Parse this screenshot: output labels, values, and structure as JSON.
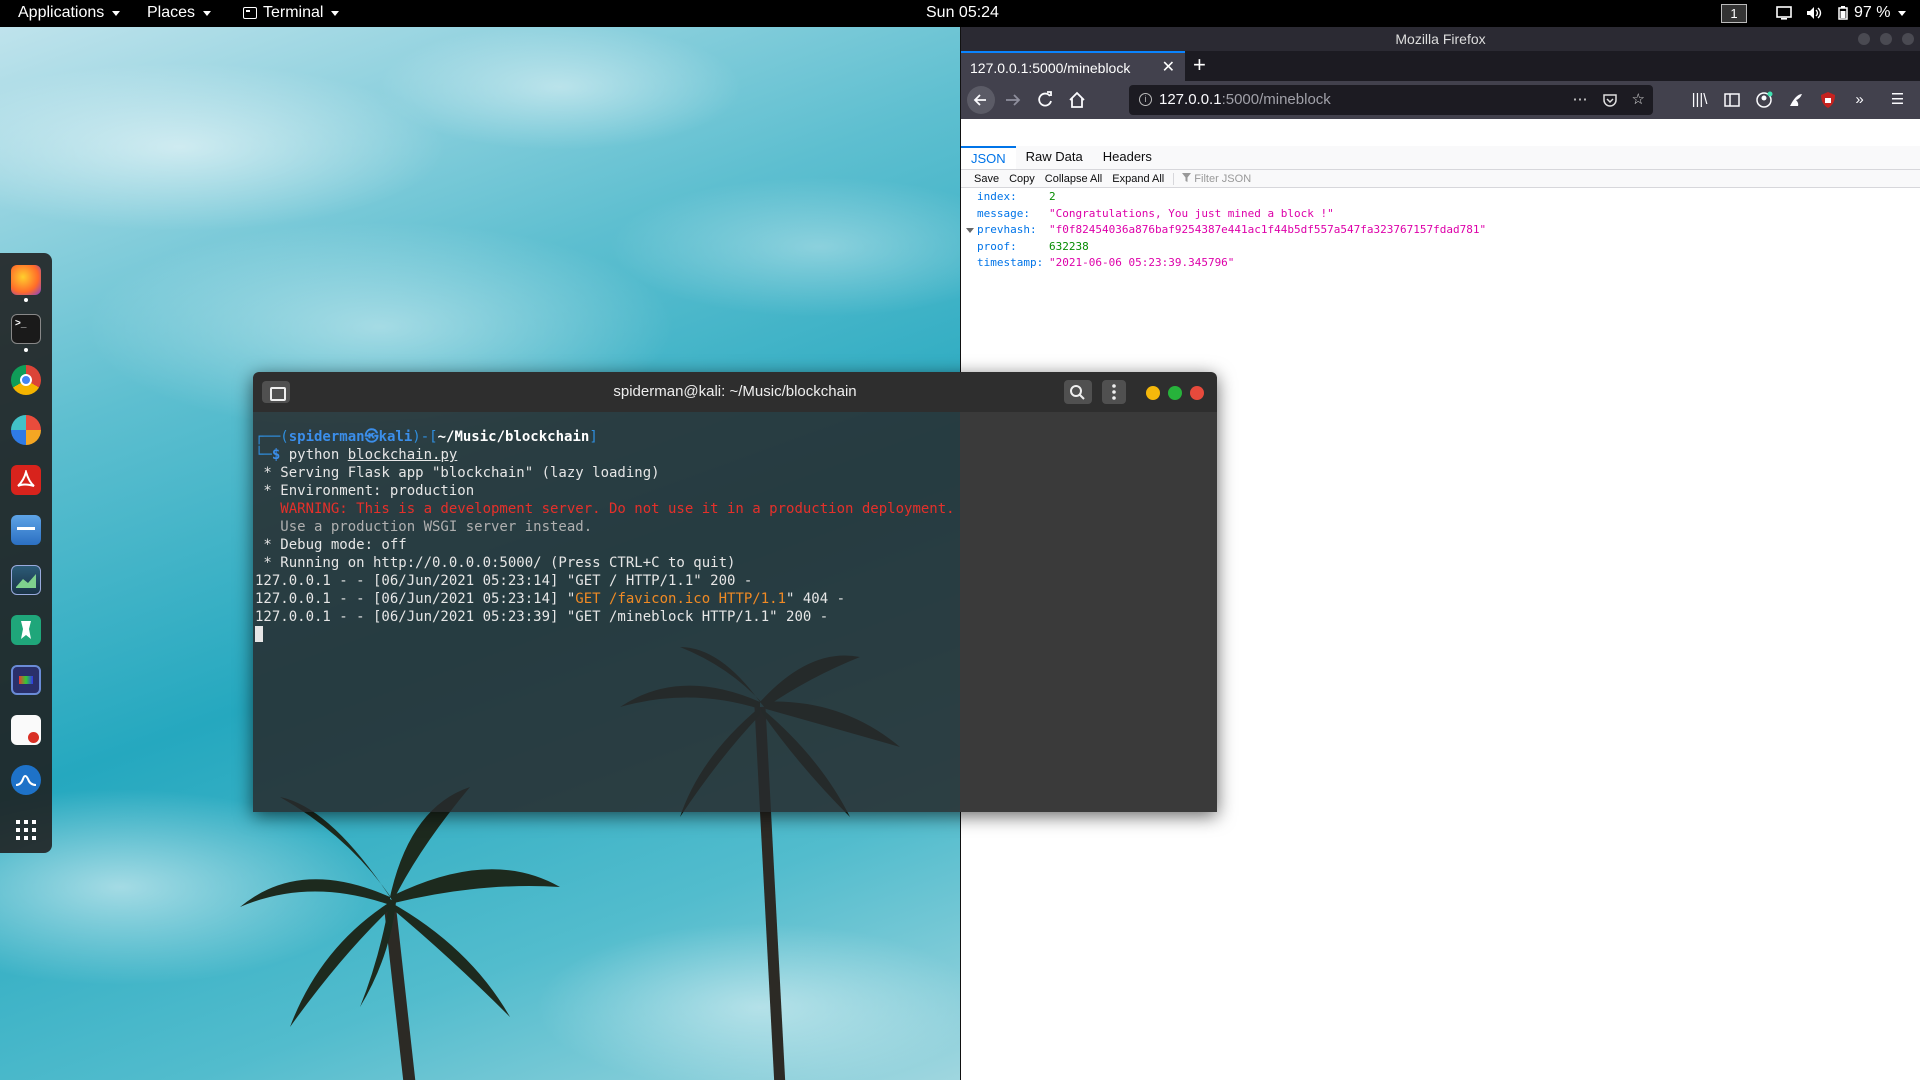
{
  "topbar": {
    "applications": "Applications",
    "places": "Places",
    "terminal": "Terminal",
    "clock": "Sun 05:24",
    "workspace": "1",
    "battery": "97 %"
  },
  "dock": {
    "apps": [
      "firefox-icon",
      "terminal-icon",
      "chrome-icon",
      "pie-icon",
      "pdf-icon",
      "files-icon",
      "image-viewer-icon",
      "vpn-icon",
      "remote-desktop-icon",
      "text-editor-icon",
      "wireshark-icon",
      "app-grid-icon"
    ]
  },
  "firefox": {
    "window_title": "Mozilla Firefox",
    "tab_title": "127.0.0.1:5000/mineblock",
    "url_host": "127.0.0.1",
    "url_path": ":5000/mineblock",
    "viewer_tabs": [
      "JSON",
      "Raw Data",
      "Headers"
    ],
    "toolbar": {
      "save": "Save",
      "copy": "Copy",
      "collapse_all": "Collapse All",
      "expand_all": "Expand All",
      "filter_placeholder": "Filter JSON"
    },
    "json_rows": [
      {
        "key": "index:",
        "value": "2",
        "type": "num"
      },
      {
        "key": "message:",
        "value": "\"Congratulations, You just mined a block !\"",
        "type": "str"
      },
      {
        "key": "prevhash:",
        "value": "\"f0f82454036a876baf9254387e441ac1f44b5df557a547fa323767157fdad781\"",
        "type": "str"
      },
      {
        "key": "proof:",
        "value": "632238",
        "type": "num"
      },
      {
        "key": "timestamp:",
        "value": "\"2021-06-06 05:23:39.345796\"",
        "type": "str"
      }
    ]
  },
  "terminal": {
    "title": "spiderman@kali: ~/Music/blockchain",
    "prompt_user": "spiderman㉿kali",
    "prompt_dir": "~/Music/blockchain",
    "command": "python",
    "command_arg": "blockchain.py",
    "lines": {
      "serving": " * Serving Flask app \"blockchain\" (lazy loading)",
      "environment": " * Environment: production",
      "warning": "   WARNING: This is a development server. Do not use it in a production deployment.",
      "wsgi": "   Use a production WSGI server instead.",
      "debug": " * Debug mode: off",
      "running": " * Running on http://0.0.0.0:5000/ (Press CTRL+C to quit)",
      "log1": "127.0.0.1 - - [06/Jun/2021 05:23:14] \"GET / HTTP/1.1\" 200 -",
      "log2_prefix": "127.0.0.1 - - [06/Jun/2021 05:23:14] \"",
      "log2_req": "GET /favicon.ico HTTP/1.1",
      "log2_suffix": "\" 404 -",
      "log3": "127.0.0.1 - - [06/Jun/2021 05:23:39] \"GET /mineblock HTTP/1.1\" 200 -"
    }
  }
}
